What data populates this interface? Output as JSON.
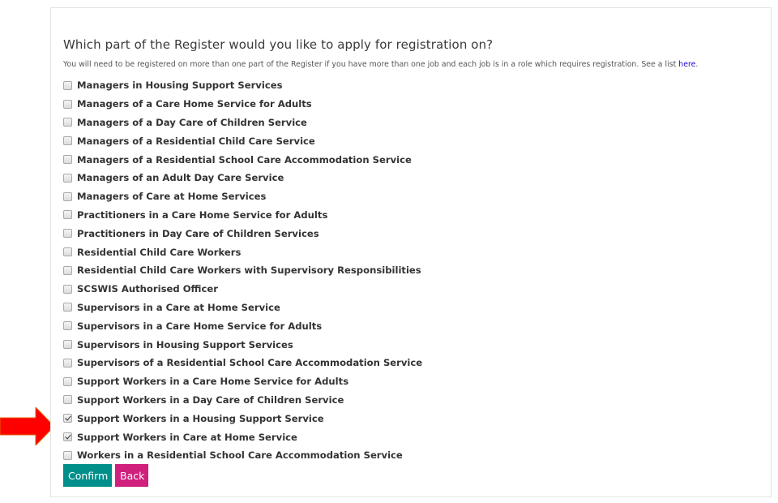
{
  "form": {
    "title": "Which part of the Register would you like to apply for registration on?",
    "subtitle": "You will need to be registered on more than one part of the Register if you have more than one job and each job is in a role which requires registration. See a list ",
    "subtitle_link": "here",
    "subtitle_end": ".",
    "options": [
      {
        "label": "Managers in Housing Support Services",
        "checked": false
      },
      {
        "label": "Managers of a Care Home Service for Adults",
        "checked": false
      },
      {
        "label": "Managers of a Day Care of Children Service",
        "checked": false
      },
      {
        "label": "Managers of a Residential Child Care Service",
        "checked": false
      },
      {
        "label": "Managers of a Residential School Care Accommodation Service",
        "checked": false
      },
      {
        "label": "Managers of an Adult Day Care Service",
        "checked": false
      },
      {
        "label": "Managers of Care at Home Services",
        "checked": false
      },
      {
        "label": "Practitioners in a Care Home Service for Adults",
        "checked": false
      },
      {
        "label": "Practitioners in Day Care of Children Services",
        "checked": false
      },
      {
        "label": "Residential Child Care Workers",
        "checked": false
      },
      {
        "label": "Residential Child Care Workers with Supervisory Responsibilities",
        "checked": false
      },
      {
        "label": "SCSWIS Authorised Officer",
        "checked": false
      },
      {
        "label": "Supervisors in a Care at Home Service",
        "checked": false
      },
      {
        "label": "Supervisors in a Care Home Service for Adults",
        "checked": false
      },
      {
        "label": "Supervisors in Housing Support Services",
        "checked": false
      },
      {
        "label": "Supervisors of a Residential School Care Accommodation Service",
        "checked": false
      },
      {
        "label": "Support Workers in a Care Home Service for Adults",
        "checked": false
      },
      {
        "label": "Support Workers in a Day Care of Children Service",
        "checked": false
      },
      {
        "label": "Support Workers in a Housing Support Service",
        "checked": true
      },
      {
        "label": "Support Workers in Care at Home Service",
        "checked": true
      },
      {
        "label": "Workers in a Residential School Care Accommodation Service",
        "checked": false
      }
    ],
    "confirm_label": "Confirm",
    "back_label": "Back"
  },
  "annotation": {
    "icon": "red-arrow-icon",
    "color": "#ff0000",
    "points_to": "Support Workers in a Housing Support Service"
  },
  "colors": {
    "confirm": "#008f8a",
    "back": "#d01f7d",
    "link": "#1a0dcc"
  }
}
